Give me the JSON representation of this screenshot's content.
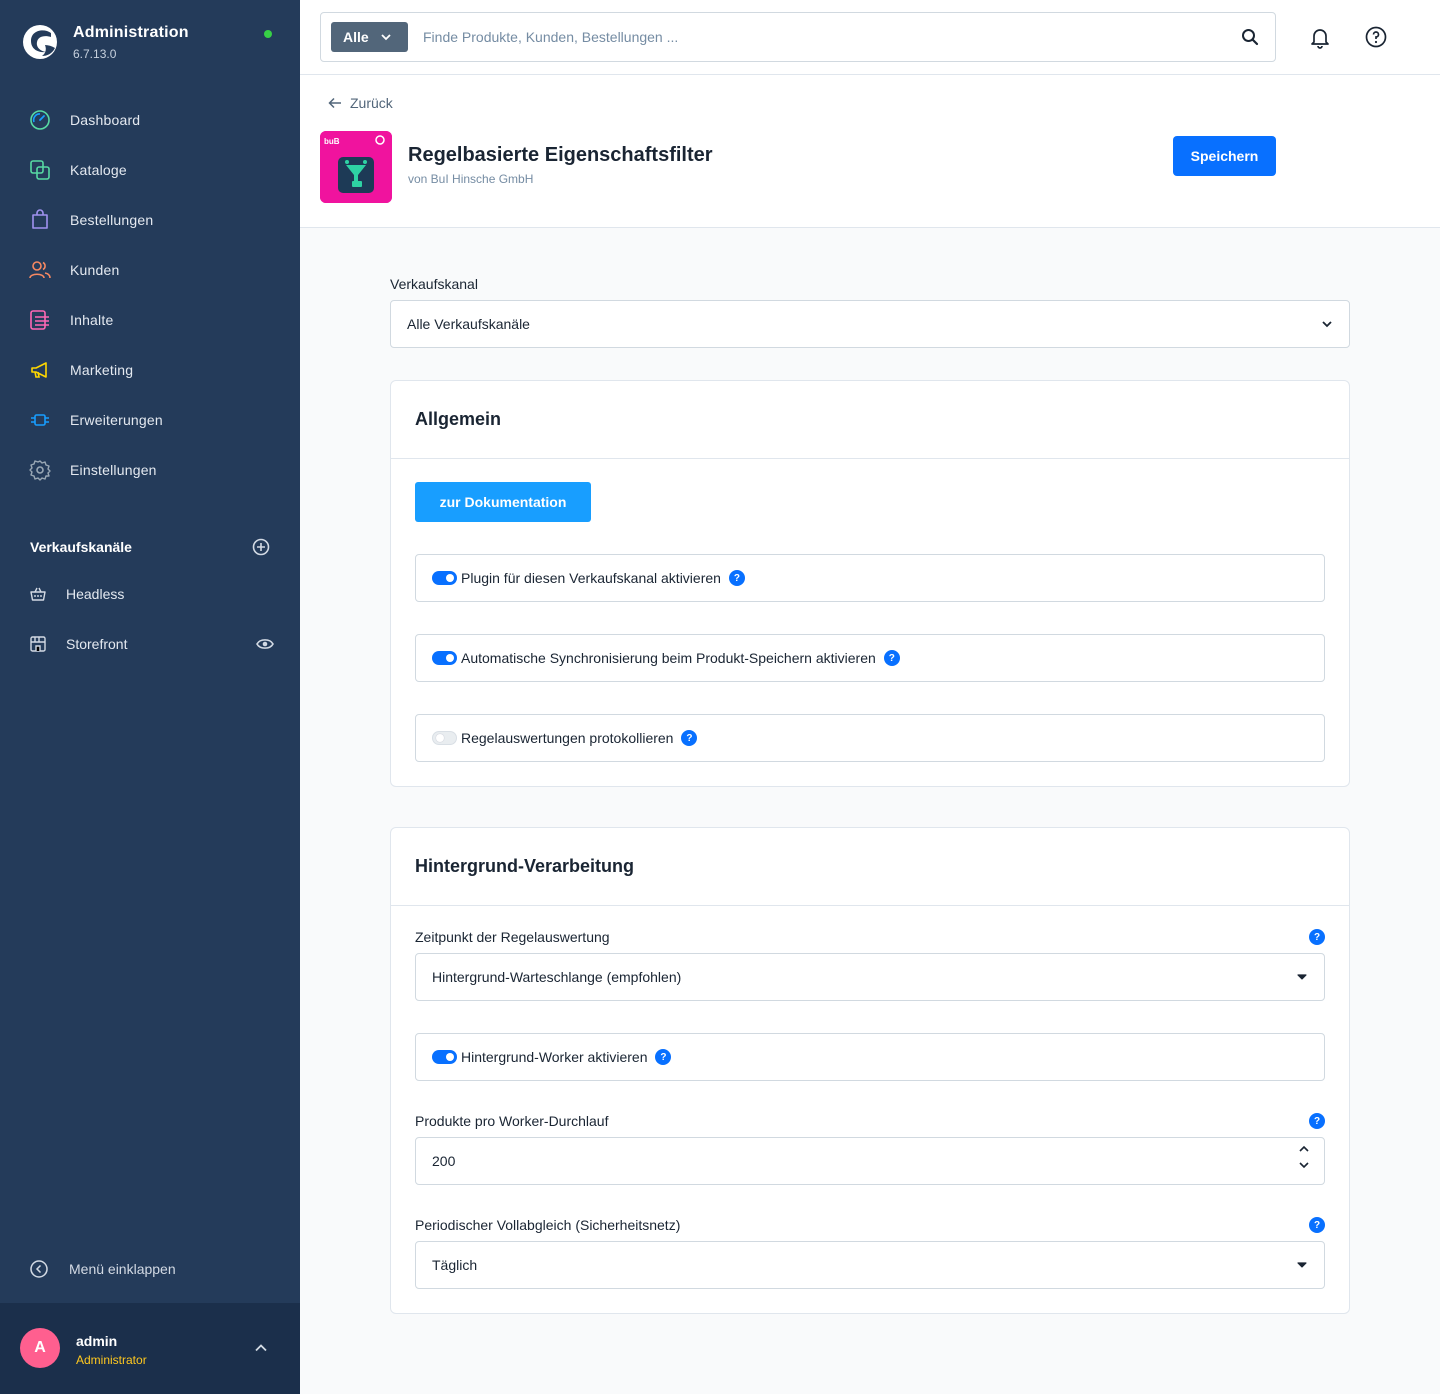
{
  "sidebar": {
    "title": "Administration",
    "version": "6.7.13.0",
    "nav": [
      {
        "label": "Dashboard",
        "icon": "dashboard-icon",
        "color": "#57d9a3"
      },
      {
        "label": "Kataloge",
        "icon": "catalog-icon",
        "color": "#57d9a3"
      },
      {
        "label": "Bestellungen",
        "icon": "orders-icon",
        "color": "#a092f0"
      },
      {
        "label": "Kunden",
        "icon": "customers-icon",
        "color": "#f88962"
      },
      {
        "label": "Inhalte",
        "icon": "content-icon",
        "color": "#ff68b4"
      },
      {
        "label": "Marketing",
        "icon": "marketing-icon",
        "color": "#ffd700"
      },
      {
        "label": "Erweiterungen",
        "icon": "extensions-icon",
        "color": "#189eff"
      },
      {
        "label": "Einstellungen",
        "icon": "settings-icon",
        "color": "#9aa8b5"
      }
    ],
    "sales_channels_title": "Verkaufskanäle",
    "sales_channels": [
      {
        "label": "Headless"
      },
      {
        "label": "Storefront"
      }
    ],
    "collapse_label": "Menü einklappen",
    "user": {
      "initial": "A",
      "name": "admin",
      "role": "Administrator"
    }
  },
  "topbar": {
    "search_type": "Alle",
    "search_placeholder": "Finde Produkte, Kunden, Bestellungen ..."
  },
  "header": {
    "back_label": "Zurück",
    "plugin_title": "Regelbasierte Eigenschaftsfilter",
    "plugin_vendor": "von BuI Hinsche GmbH",
    "plugin_logo_text": "buB",
    "save_label": "Speichern"
  },
  "sales_channel": {
    "label": "Verkaufskanal",
    "value": "Alle Verkaufskanäle"
  },
  "general": {
    "title": "Allgemein",
    "doc_button": "zur Dokumentation",
    "toggles": [
      {
        "label": "Plugin für diesen Verkaufskanal aktivieren",
        "on": true
      },
      {
        "label": "Automatische Synchronisierung beim Produkt-Speichern aktivieren",
        "on": true
      },
      {
        "label": "Regelauswertungen protokollieren",
        "on": false
      }
    ]
  },
  "background": {
    "title": "Hintergrund-Verarbeitung",
    "timing_label": "Zeitpunkt der Regelauswertung",
    "timing_value": "Hintergrund-Warteschlange (empfohlen)",
    "worker_toggle_label": "Hintergrund-Worker aktivieren",
    "worker_toggle_on": true,
    "products_label": "Produkte pro Worker-Durchlauf",
    "products_value": "200",
    "periodic_label": "Periodischer Vollabgleich (Sicherheitsnetz)",
    "periodic_value": "Täglich"
  },
  "help_glyph": "?",
  "colors": {
    "sidebar": "#243b5a",
    "primary": "#0870ff",
    "doc_button": "#189eff",
    "plugin_bg": "#f0139e"
  }
}
